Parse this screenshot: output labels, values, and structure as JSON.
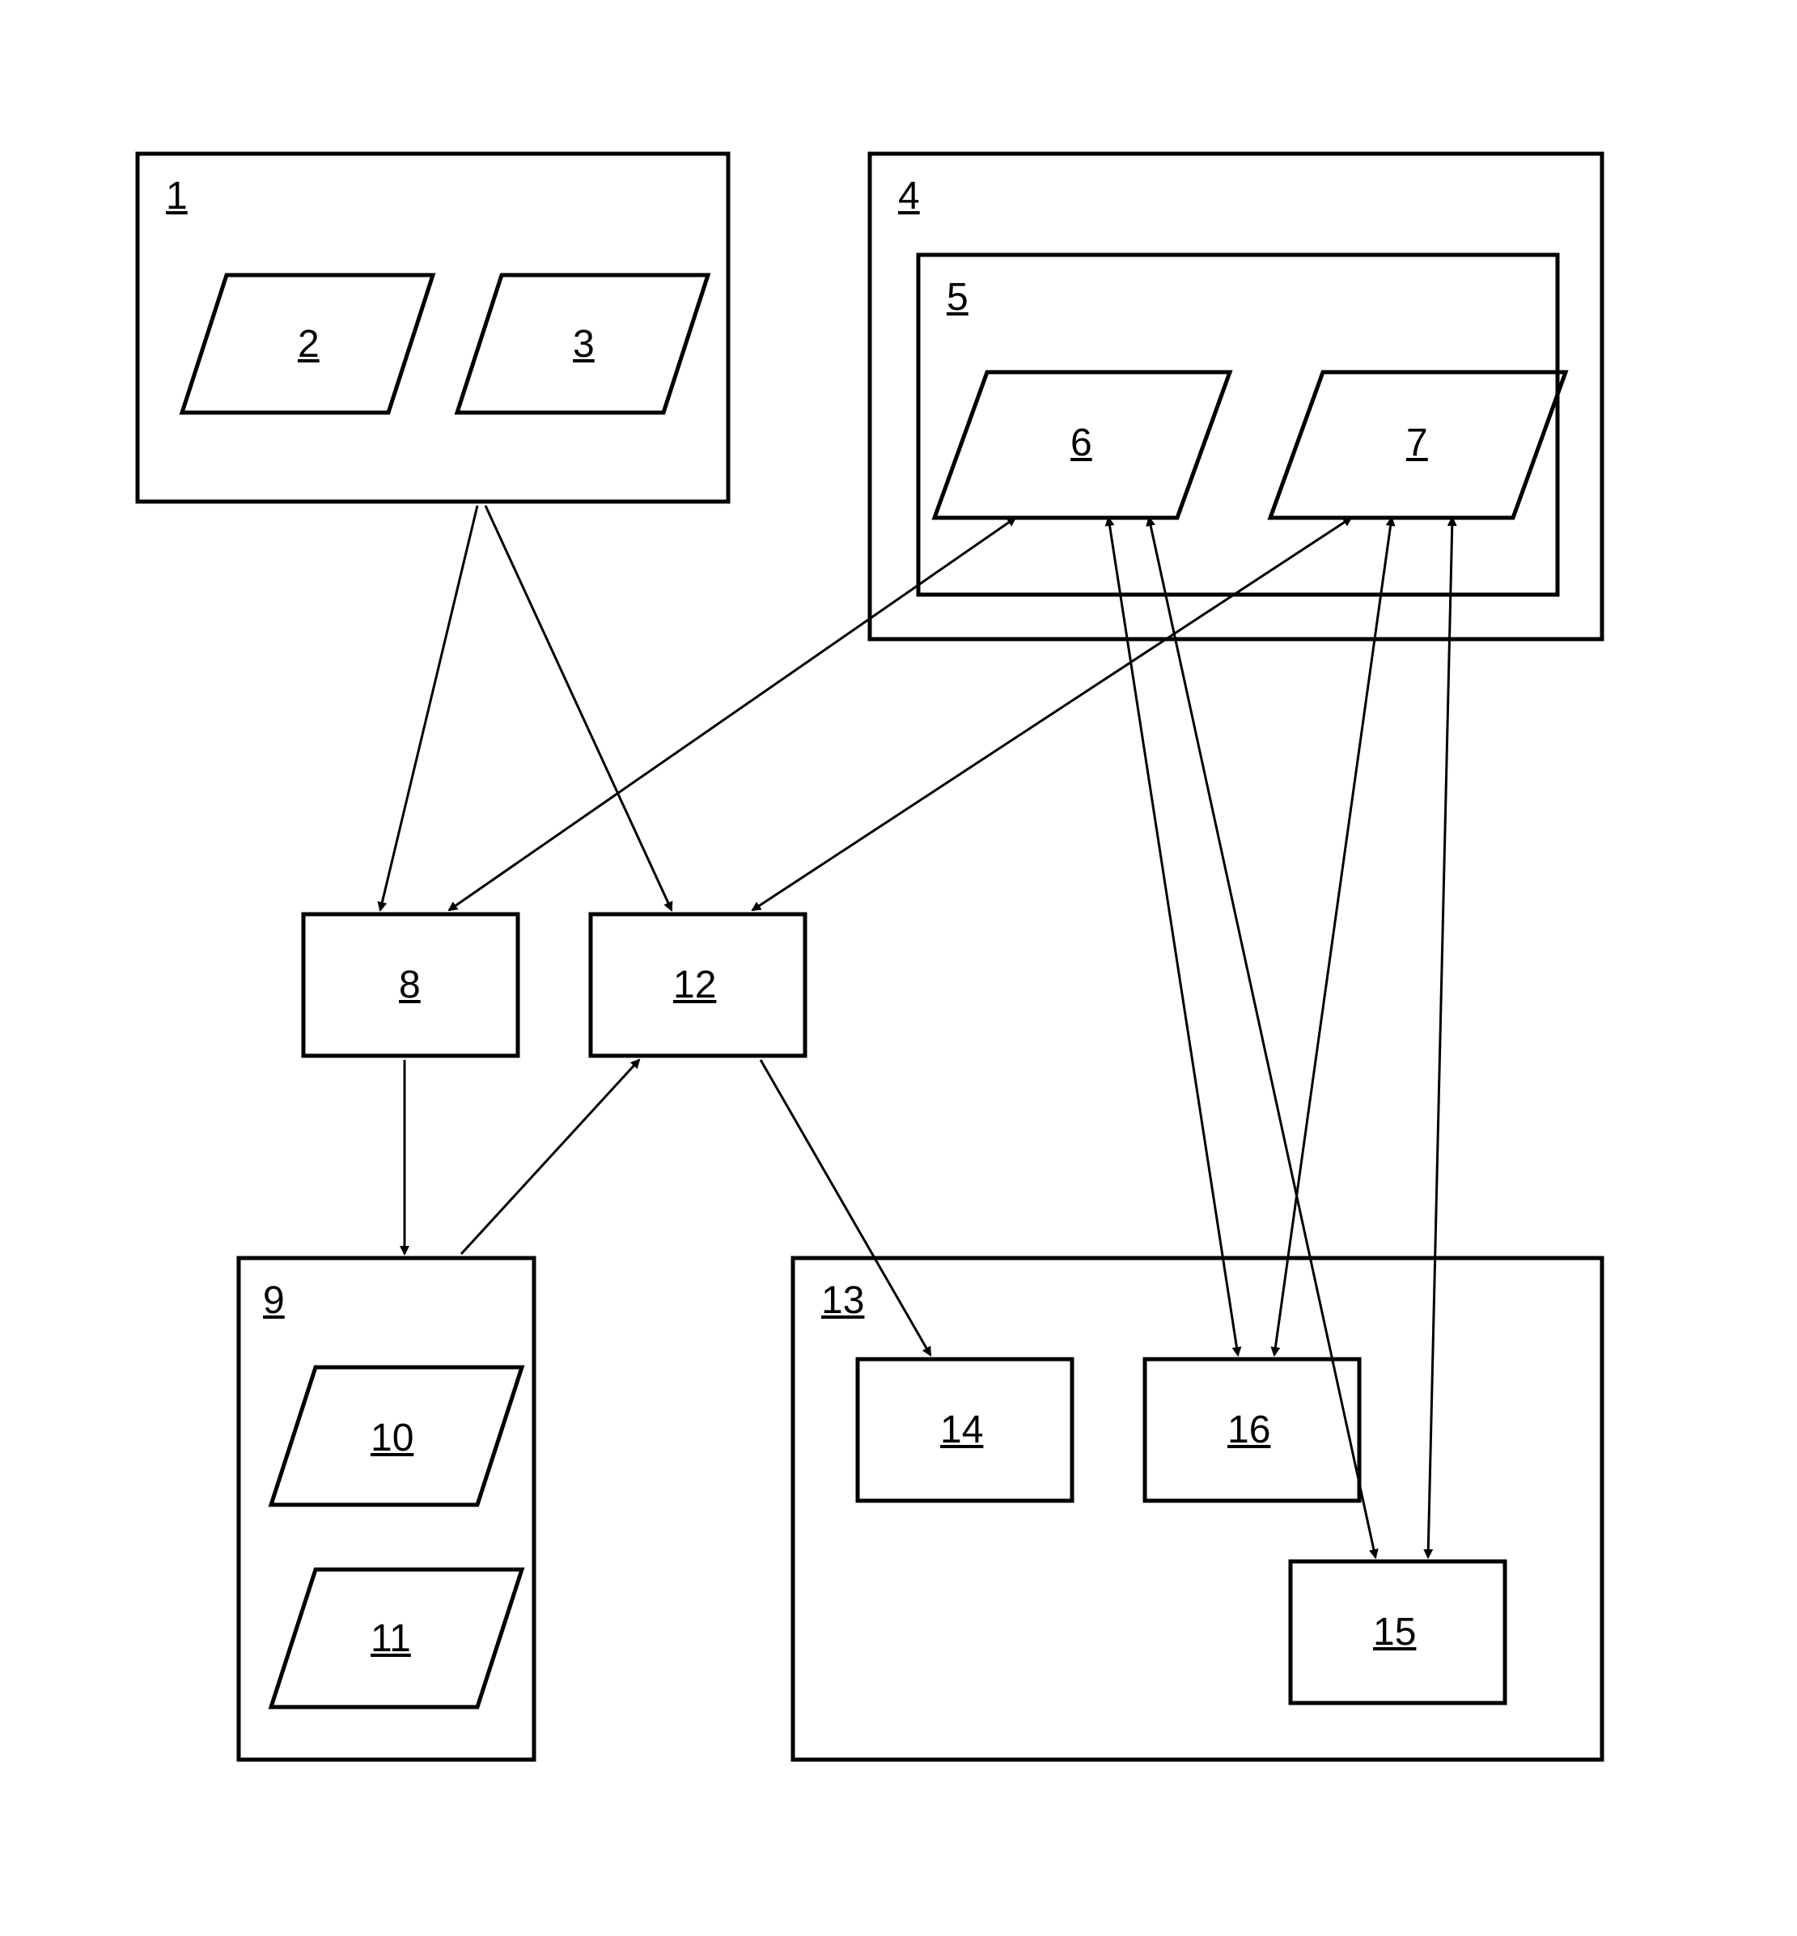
{
  "nodes": {
    "box1": {
      "label": "1"
    },
    "par2": {
      "label": "2"
    },
    "par3": {
      "label": "3"
    },
    "box4": {
      "label": "4"
    },
    "box5": {
      "label": "5"
    },
    "par6": {
      "label": "6"
    },
    "par7": {
      "label": "7"
    },
    "rect8": {
      "label": "8"
    },
    "box9": {
      "label": "9"
    },
    "par10": {
      "label": "10"
    },
    "par11": {
      "label": "11"
    },
    "rect12": {
      "label": "12"
    },
    "box13": {
      "label": "13"
    },
    "rect14": {
      "label": "14"
    },
    "rect15": {
      "label": "15"
    },
    "rect16": {
      "label": "16"
    }
  },
  "edges": [
    {
      "from": "box1",
      "to": "rect8",
      "arrow_start": false,
      "arrow_end": true
    },
    {
      "from": "box1",
      "to": "rect12",
      "arrow_start": false,
      "arrow_end": true
    },
    {
      "from": "par6",
      "to": "rect8",
      "arrow_start": true,
      "arrow_end": true
    },
    {
      "from": "par7",
      "to": "rect12",
      "arrow_start": true,
      "arrow_end": true
    },
    {
      "from": "rect8",
      "to": "box9",
      "arrow_start": false,
      "arrow_end": true
    },
    {
      "from": "box9",
      "to": "rect12",
      "arrow_start": false,
      "arrow_end": true
    },
    {
      "from": "rect12",
      "to": "rect14",
      "arrow_start": false,
      "arrow_end": true
    },
    {
      "from": "par6",
      "to": "rect16",
      "arrow_start": true,
      "arrow_end": true
    },
    {
      "from": "par7",
      "to": "rect16",
      "arrow_start": true,
      "arrow_end": true
    },
    {
      "from": "par6",
      "to": "rect15",
      "arrow_start": true,
      "arrow_end": true
    },
    {
      "from": "par7",
      "to": "rect15",
      "arrow_start": true,
      "arrow_end": true
    }
  ]
}
